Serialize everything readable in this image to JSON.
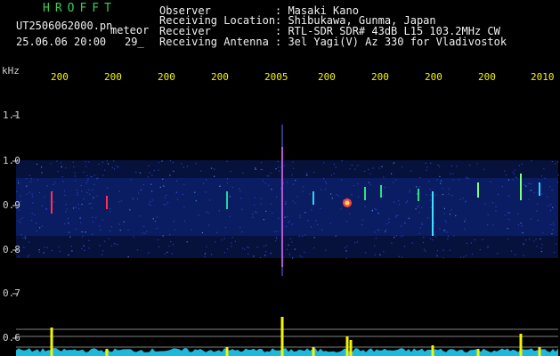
{
  "header": {
    "program": "HROFFT",
    "filename": "UT2506062000.pn",
    "mode": "meteor",
    "datetime": "25.06.06 20:00",
    "count": "29_",
    "observer_label": "Observer",
    "observer_value": ": Masaki Kano",
    "location_label": "Receiving Location",
    "location_value": ": Shibukawa, Gunma, Japan",
    "receiver_label": "Receiver",
    "receiver_value": ": RTL-SDR SDR# 43dB L15 103.2MHz CW",
    "antenna_label": "Receiving Antenna",
    "antenna_value": ": 3el Yagi(V) Az 330 for Vladivostok"
  },
  "axis": {
    "unit": "kHz",
    "y_ticks": [
      "1.1",
      "1.0",
      "0.9",
      "0.8",
      "0.7",
      "0.6"
    ],
    "x_ticks": [
      "200",
      "200",
      "200",
      "200",
      "2005",
      "200",
      "200",
      "200",
      "200",
      "2010"
    ]
  },
  "colors": {
    "background": "#000000",
    "header_text": "#f0f0f0",
    "program": "#34d34f",
    "time_label": "#f5f500",
    "noise_band": "#0b1f6e",
    "signal": "#ff3040",
    "histogram": "#f5f500",
    "noise_floor": "#1fb8d8"
  }
}
